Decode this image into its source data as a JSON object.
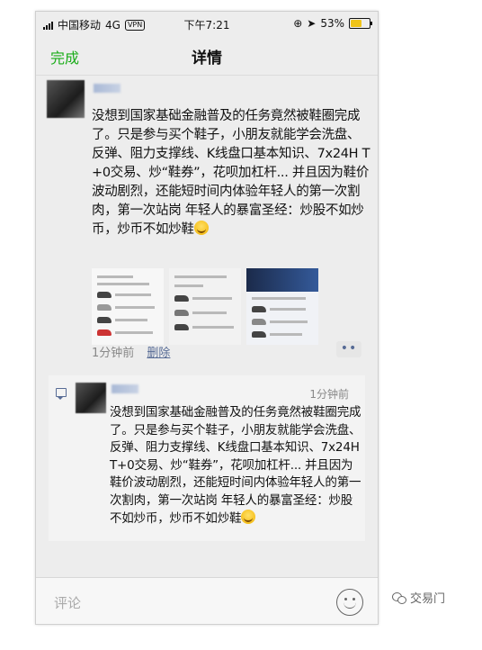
{
  "status": {
    "carrier": "中国移动",
    "network": "4G",
    "vpn": "VPN",
    "time": "下午7:21",
    "battery": "53%",
    "battery_level": 0.53
  },
  "nav": {
    "done_label": "完成",
    "title": "详情"
  },
  "post": {
    "text": "没想到国家基础金融普及的任务竟然被鞋圈完成了。只是参与买个鞋子，小朋友就能学会洗盘、反弹、阻力支撑线、K线盘口基本知识、7x24H T+0交易、炒“鞋券”，花呗加杠杆... 并且因为鞋价波动剧烈，还能短时间内体验年轻人的第一次割肉，第一次站岗 年轻人的暴富圣经：炒股不如炒币，炒币不如炒鞋",
    "time_ago": "1分钟前",
    "delete_label": "删除",
    "more_label": "••"
  },
  "comment": {
    "time": "1分钟前",
    "text": "没想到国家基础金融普及的任务竟然被鞋圈完成了。只是参与买个鞋子，小朋友就能学会洗盘、反弹、阻力支撑线、K线盘口基本知识、7x24H T+0交易、炒“鞋券”，花呗加杠杆... 并且因为鞋价波动剧烈，还能短时间内体验年轻人的第一次割肉，第一次站岗 年轻人的暴富圣经：炒股不如炒币，炒币不如炒鞋"
  },
  "input": {
    "placeholder": "评论"
  },
  "watermark": {
    "text": "交易门"
  },
  "colors": {
    "accent": "#1aad19",
    "link": "#576b95",
    "background": "#ededed"
  },
  "icons": [
    "signal-icon",
    "location-icon",
    "battery-icon",
    "comment-icon",
    "emoji-icon",
    "wechat-icon"
  ]
}
